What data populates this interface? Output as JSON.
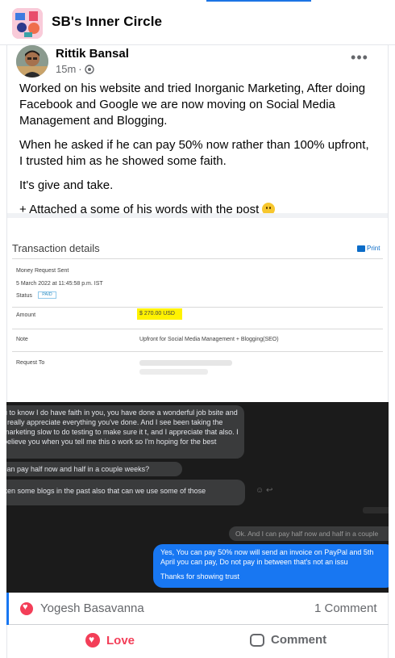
{
  "group": {
    "name": "SB's Inner Circle",
    "icon": "group-cover-icon"
  },
  "post": {
    "author": "Rittik Bansal",
    "time": "15m",
    "separator": "·",
    "privacy_icon": "globe-icon",
    "more_icon": "more-options-icon",
    "more_label": "•••",
    "paragraphs": [
      "Worked on his website and tried Inorganic Marketing, After doing Facebook and Google we are now moving on Social Media Management and Blogging.",
      "When he asked if he can pay 50% now rather than 100% upfront, I trusted him as he showed some faith.",
      "It's give and take.",
      "+ Attached a some of his words with the post"
    ]
  },
  "transaction": {
    "title": "Transaction details",
    "print_label": "Print",
    "request_type": "Money Request Sent",
    "date": "5 March 2022 at 11:45:58 p.m. IST",
    "status_label": "Status",
    "status_value": "PAID",
    "amount_label": "Amount",
    "amount_value": "$ 270.00 USD",
    "note_label": "Note",
    "note_value": "Upfront for Social Media Management + Blogging(SEO)",
    "request_to_label": "Request To",
    "highlight_color": "#fff200"
  },
  "chat": {
    "incoming": [
      "u to know I do have faith in you, you have done a wonderful job bsite and I really appreciate everything you've done. And I see been taking the marketing slow to do testing to make sure it t, and I appreciate that also. I believe you when you tell me this o work so I'm hoping for the best",
      "can pay half now and half in a couple weeks?",
      "tten some blogs in the past also that can we use some of those"
    ],
    "quoted": "Ok. And I can pay half now and half in a couple",
    "outgoing": "Yes, You can pay 50% now will send an invoice on PayPal and 5th April you can pay, Do not pay in between that's not an issu",
    "outgoing_thanks": "Thanks for showing trust",
    "colors": {
      "background": "#1b1b1b",
      "incoming": "#3a3b3c",
      "outgoing": "#1877f2"
    }
  },
  "reactions": {
    "reactor": "Yogesh Basavanna",
    "comments": "1 Comment",
    "reaction_icon": "love-reaction-icon"
  },
  "actions": {
    "love": "Love",
    "comment": "Comment"
  },
  "colors": {
    "accent": "#1877f2",
    "love": "#f33e58",
    "text_secondary": "#65676b"
  }
}
